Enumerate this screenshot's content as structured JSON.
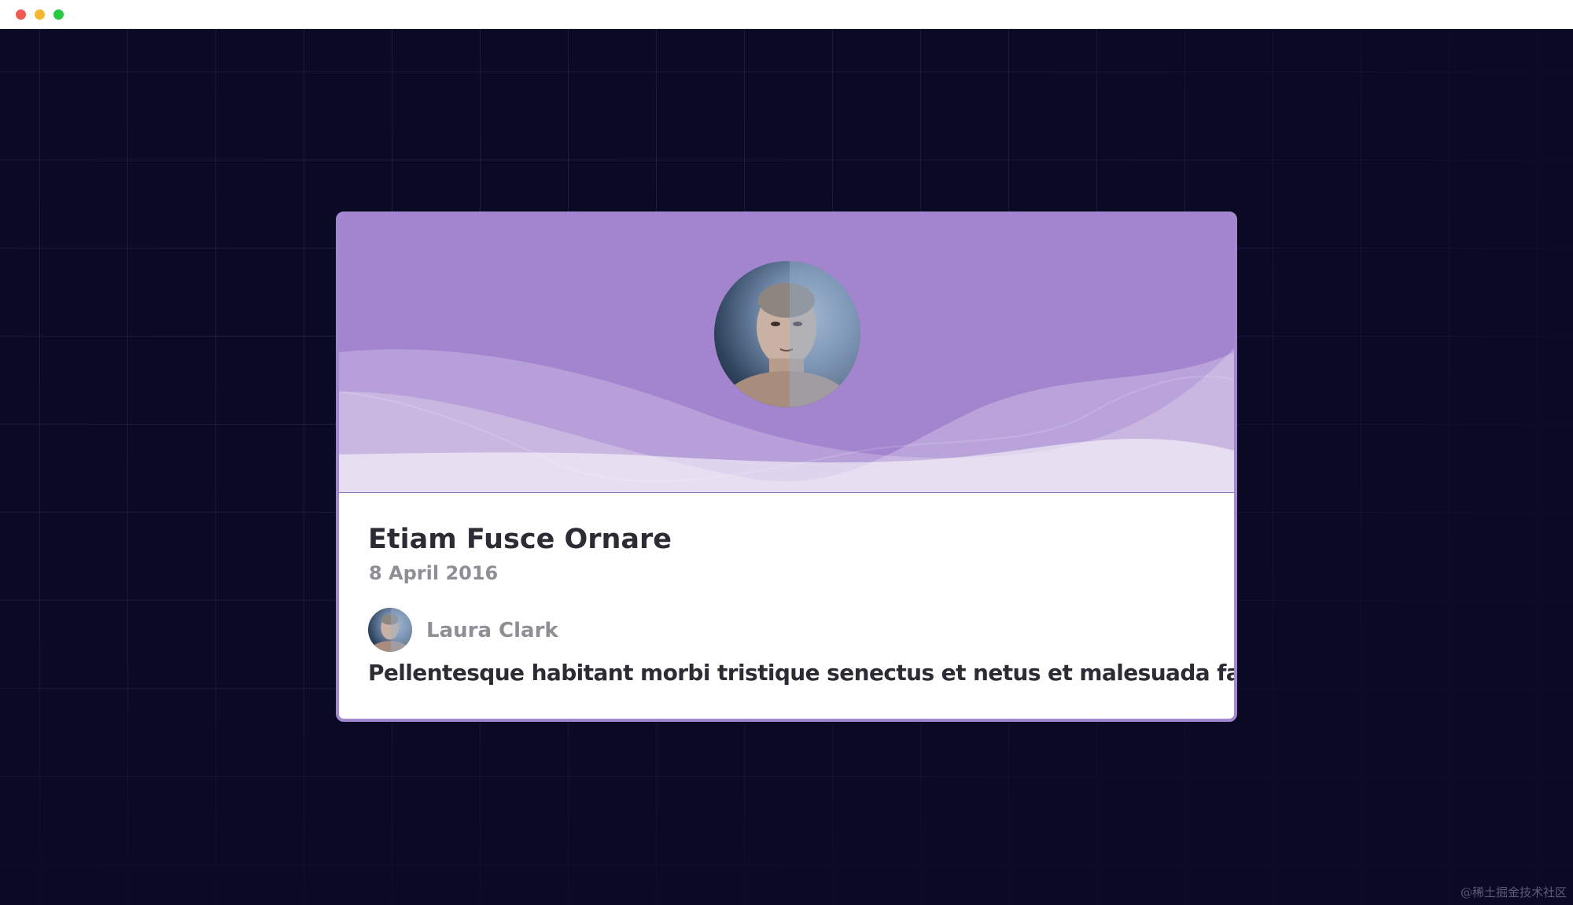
{
  "window": {
    "controls": [
      "close",
      "minimize",
      "maximize"
    ]
  },
  "card": {
    "title": "Etiam Fusce Ornare",
    "date": "8 April 2016",
    "author": {
      "name": "Laura Clark"
    },
    "excerpt": "Pellentesque habitant morbi tristique senectus et netus et malesuada fames."
  },
  "watermark": "@稀土掘金技术社区",
  "colors": {
    "background": "#0b0a24",
    "card_header": "#a384cf",
    "card_border": "#a487d1",
    "title_text": "#2c2c34",
    "muted_text": "#8e8e95"
  }
}
